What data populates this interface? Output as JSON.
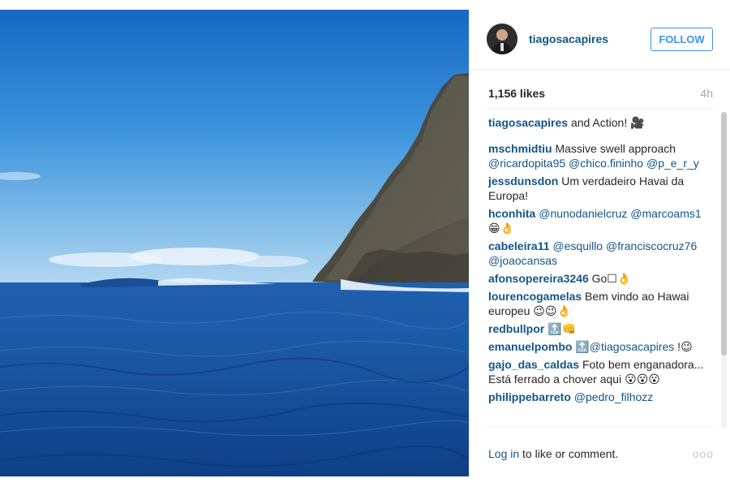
{
  "header": {
    "username": "tiagosacapires",
    "follow_label": "FOLLOW"
  },
  "stats": {
    "likes": "1,156 likes",
    "time": "4h"
  },
  "caption": {
    "user": "tiagosacapires",
    "text": "and Action! 🎥"
  },
  "comments": [
    {
      "user": "mschmidtiu",
      "segments": [
        {
          "t": "text",
          "v": "Massive swell approach "
        },
        {
          "t": "mention",
          "v": "@ricardopita95"
        },
        {
          "t": "text",
          "v": " "
        },
        {
          "t": "mention",
          "v": "@chico.fininho"
        },
        {
          "t": "text",
          "v": " "
        },
        {
          "t": "mention",
          "v": "@p_e_r_y"
        }
      ]
    },
    {
      "user": "jessdunsdon",
      "segments": [
        {
          "t": "text",
          "v": "Um verdadeiro Havai da Europa!"
        }
      ]
    },
    {
      "user": "hconhita",
      "segments": [
        {
          "t": "mention",
          "v": "@nunodanielcruz"
        },
        {
          "t": "text",
          "v": " "
        },
        {
          "t": "mention",
          "v": "@marcoams1"
        },
        {
          "t": "text",
          "v": " 😁👌"
        }
      ]
    },
    {
      "user": "cabeleira11",
      "segments": [
        {
          "t": "mention",
          "v": "@esquillo"
        },
        {
          "t": "text",
          "v": " "
        },
        {
          "t": "mention",
          "v": "@franciscocruz76"
        },
        {
          "t": "text",
          "v": " "
        },
        {
          "t": "mention",
          "v": "@joaocansas"
        }
      ]
    },
    {
      "user": "afonsopereira3246",
      "segments": [
        {
          "t": "text",
          "v": "Go☐👌"
        }
      ]
    },
    {
      "user": "lourencogamelas",
      "segments": [
        {
          "t": "text",
          "v": "Bem vindo ao Hawai europeu 😉😉👌"
        }
      ]
    },
    {
      "user": "redbullpor",
      "segments": [
        {
          "t": "text",
          "v": "🔝👊"
        }
      ]
    },
    {
      "user": "emanuelpombo",
      "segments": [
        {
          "t": "text",
          "v": "🔝"
        },
        {
          "t": "mention",
          "v": "@tiagosacapires"
        },
        {
          "t": "text",
          "v": " !😉"
        }
      ]
    },
    {
      "user": "gajo_das_caldas",
      "segments": [
        {
          "t": "text",
          "v": "Foto bem enganadora... Está ferrado a chover aqui 😮😮😮"
        }
      ]
    },
    {
      "user": "philippebarreto",
      "segments": [
        {
          "t": "mention",
          "v": "@pedro_filhozz"
        }
      ]
    }
  ],
  "footer": {
    "login_link": "Log in",
    "login_rest": " to like or comment.",
    "more": "ooo"
  },
  "icons": {
    "avatar": "avatar",
    "more": "more-options-icon"
  },
  "colors": {
    "link": "#125688",
    "follow": "#3897f0",
    "sky_top": "#1b76c8",
    "sea": "#1d4f93"
  }
}
